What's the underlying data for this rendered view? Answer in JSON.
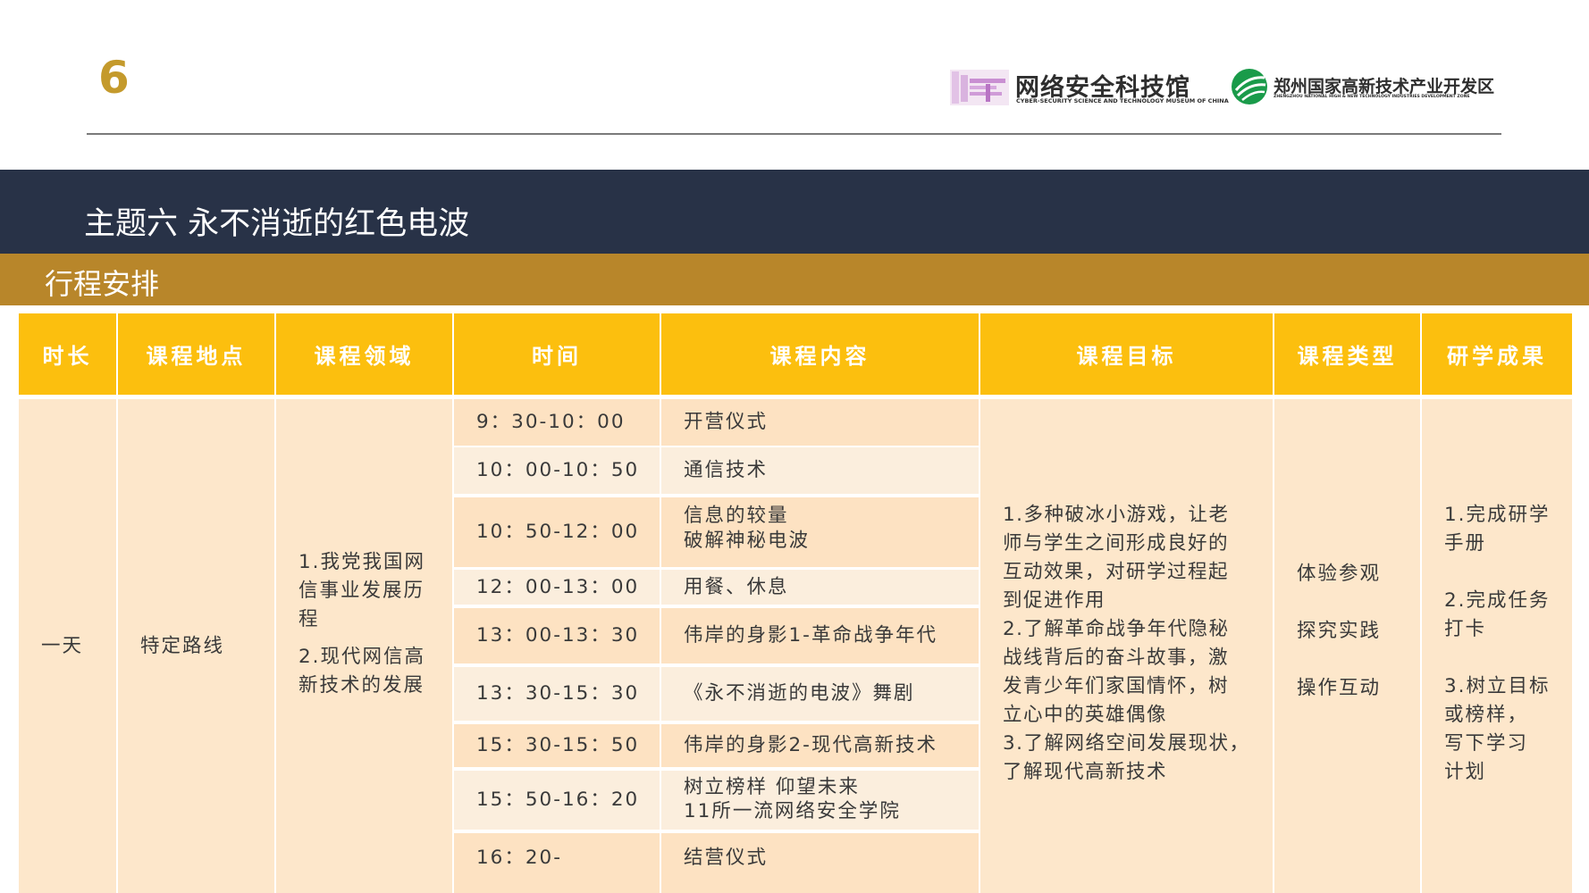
{
  "page": {
    "number": "6",
    "theme_title": "主题六 永不消逝的红色电波",
    "section_title": "行程安排"
  },
  "logos": {
    "museum": {
      "name": "网络安全科技馆",
      "subtitle": "CYBER-SECURITY SCIENCE AND TECHNOLOGY MUSEUM OF CHINA",
      "icon": "museum-logo-icon"
    },
    "zone": {
      "name": "郑州国家高新技术产业开发区",
      "subtitle": "ZHENGZHOU NATIONAL HIGH & NEW TECHNOLOGY INDUSTRIES DEVELOPMENT ZONE",
      "icon": "zone-logo-icon"
    }
  },
  "colors": {
    "accent_gold": "#c49a2c",
    "theme_band": "#283247",
    "section_band": "#b8862a",
    "table_header": "#fcbf0e",
    "table_body": "#fde7cb"
  },
  "table": {
    "headers": [
      "时长",
      "课程地点",
      "课程领域",
      "时间",
      "课程内容",
      "课程目标",
      "课程类型",
      "研学成果"
    ],
    "duration": "一天",
    "location": "特定路线",
    "domains": [
      "1.我党我国网",
      "信事业发展历",
      "程",
      "",
      "2.现代网信高",
      "新技术的发展"
    ],
    "schedule": [
      {
        "time": "9：30-10：00",
        "content": [
          "开营仪式"
        ]
      },
      {
        "time": "10：00-10：50",
        "content": [
          "通信技术"
        ]
      },
      {
        "time": "10：50-12：00",
        "content": [
          "信息的较量",
          "破解神秘电波"
        ]
      },
      {
        "time": "12：00-13：00",
        "content": [
          "用餐、休息"
        ]
      },
      {
        "time": "13：00-13：30",
        "content": [
          "伟岸的身影1-革命战争年代"
        ]
      },
      {
        "time": "13：30-15：30",
        "content": [
          "《永不消逝的电波》舞剧"
        ]
      },
      {
        "time": "15：30-15：50",
        "content": [
          "伟岸的身影2-现代高新技术"
        ]
      },
      {
        "time": "15：50-16：20",
        "content": [
          "树立榜样 仰望未来",
          "11所一流网络安全学院"
        ]
      },
      {
        "time": "16：20-",
        "content": [
          "结营仪式"
        ]
      }
    ],
    "goals": [
      "1.多种破冰小游戏，让老",
      "师与学生之间形成良好的",
      "互动效果，对研学过程起",
      "到促进作用",
      "2.了解革命战争年代隐秘",
      "战线背后的奋斗故事，激",
      "发青少年们家国情怀，树",
      "立心中的英雄偶像",
      "3.了解网络空间发展现状，",
      "了解现代高新技术"
    ],
    "types": [
      "体验参观",
      "探究实践",
      "操作互动"
    ],
    "outcomes": [
      "1.完成研学",
      "手册",
      "",
      "2.完成任务",
      "打卡",
      "",
      "3.树立目标",
      "或榜样，",
      "写下学习",
      "计划"
    ]
  }
}
